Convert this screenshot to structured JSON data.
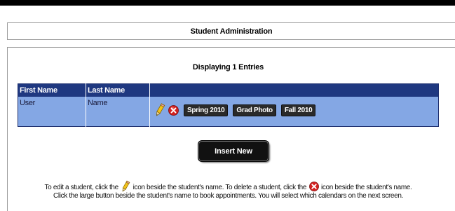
{
  "header": {
    "title": "Student Administration"
  },
  "listing": {
    "count_text": "Displaying 1 Entries",
    "columns": [
      "First Name",
      "Last Name",
      ""
    ],
    "rows": [
      {
        "first_name": "User",
        "last_name": "Name",
        "calendar_buttons": [
          "Spring 2010",
          "Grad Photo",
          "Fall 2010"
        ]
      }
    ]
  },
  "actions": {
    "insert_label": "Insert New"
  },
  "help": {
    "line1_part1": "To edit a student, click the",
    "line1_part2": "icon beside the student's name. To delete a student, click the",
    "line1_part3": "icon beside the student's name.",
    "line2": "Click the large button beside the student's name to book appointments. You will select which calendars on the next screen."
  },
  "icons": {
    "edit": "pencil-icon",
    "delete": "delete-x-icon"
  },
  "colors": {
    "table_header": "#1f3880",
    "table_row": "#84a7e4",
    "button_dark": "#2a2a2a",
    "delete_red": "#d42020",
    "pencil_yellow": "#f2c21a"
  }
}
